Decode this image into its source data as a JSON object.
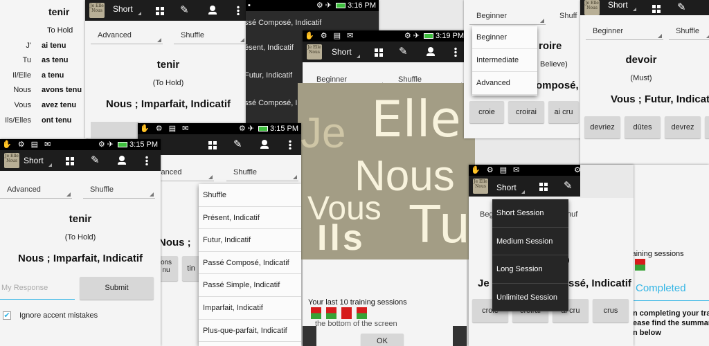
{
  "app": {
    "session_short": "Short",
    "logo_text": "Je Elle Nous"
  },
  "colors": {
    "action_bar": "#1d1d1d",
    "logo_bg": "#a39d85",
    "accent_blue": "#33b5e5",
    "success": "#36a336",
    "error": "#d61c1c"
  },
  "status": {
    "time_a": "3:16 PM",
    "time_b": "3:19 PM",
    "time_c": "3:15 PM",
    "time_d": "3:15 PM"
  },
  "conjugation_table": {
    "verb": "tenir",
    "rows": [
      {
        "pronoun": "",
        "form": "To Hold"
      },
      {
        "pronoun": "J'",
        "form": "ai tenu"
      },
      {
        "pronoun": "Tu",
        "form": "as tenu"
      },
      {
        "pronoun": "Il/Elle",
        "form": "a tenu"
      },
      {
        "pronoun": "Nous",
        "form": "avons tenu"
      },
      {
        "pronoun": "Vous",
        "form": "avez tenu"
      },
      {
        "pronoun": "Ils/Elles",
        "form": "ont tenu"
      }
    ]
  },
  "tenir_card": {
    "level": "Advanced",
    "order": "Shuffle",
    "verb": "tenir",
    "translation": "(To Hold)",
    "tense": "Nous ; Imparfait, Indicatif"
  },
  "tense_menu": {
    "level_partial": "vanced",
    "order": "Shuffle",
    "items": [
      "Shuffle",
      "Présent, Indicatif",
      "Futur, Indicatif",
      "Passé Composé, Indicatif",
      "Passé Simple, Indicatif",
      "Imparfait, Indicatif",
      "Plus-que-parfait, Indicatif"
    ],
    "bg_tense": "Nous ; ",
    "bg_btn_a": "ons\nnu",
    "bg_btn_b": "tin"
  },
  "dark_tense_list": {
    "items": [
      "ssé Composé, Indicatif",
      "ésent, Indicatif",
      "Futur, Indicatif",
      "ssé Composé, Indicatif"
    ]
  },
  "beginner_card": {
    "level": "Beginner",
    "order": "Shuffle",
    "history_label": "Your last 10 training sessions",
    "history_tail": "the bottom of the screen",
    "ok": "OK"
  },
  "level_menu": {
    "current": "Beginner",
    "order_partial": "Shuff",
    "items": [
      "Beginner",
      "Intermediate",
      "Advanced"
    ],
    "verb_partial": "roire",
    "trans_partial": "Believe)",
    "tense_partial": "omposé,",
    "buttons": [
      "croie",
      "croirai",
      "ai cru"
    ]
  },
  "session_menu": {
    "bar_label": "Short",
    "level_partial": "Beg",
    "order_partial": "huf",
    "items": [
      "Short Session",
      "Medium Session",
      "Long Session",
      "Unlimited Session"
    ],
    "tense_left": "Je",
    "tense_right": "ssé, Indicatif",
    "buttons": [
      "croie",
      "croirai",
      "ai cru",
      "crus"
    ]
  },
  "devoir_card": {
    "level": "Beginner",
    "order": "Shuffle",
    "verb": "devoir",
    "translation": "(Must)",
    "tense": "Vous ; Futur, Indicatif",
    "buttons": [
      "devriez",
      "dûtes",
      "devrez"
    ]
  },
  "completed": {
    "history_label": "Your last 10 training sessions",
    "title": "Completed",
    "line1": "n completing your trai",
    "line2": "ease find the summary",
    "line3": "n below"
  },
  "response_card": {
    "level": "Advanced",
    "order": "Shuffle",
    "verb": "tenir",
    "translation": "(To Hold)",
    "tense": "Nous ; Imparfait, Indicatif",
    "input_placeholder": "My Response",
    "submit": "Submit",
    "ignore_accents": "Ignore accent mistakes"
  },
  "big_logo": {
    "words": [
      "Je",
      "Elle",
      "Nous",
      "Vous",
      "Tu",
      "Ils"
    ]
  }
}
